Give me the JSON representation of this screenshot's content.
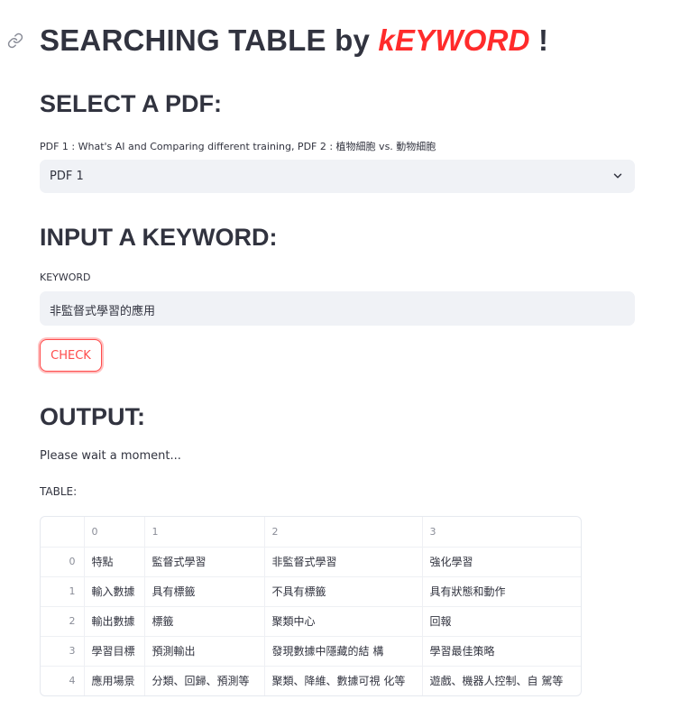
{
  "header": {
    "title_prefix": "SEARCHING TABLE by ",
    "title_keyword": "kEYWORD",
    "title_suffix": " !",
    "link_icon": "link-icon"
  },
  "select_section": {
    "heading": "SELECT A PDF:",
    "label": "PDF 1 : What's AI and Comparing different training, PDF 2 : 植物細胞 vs. 動物細胞",
    "selected_value": "PDF 1",
    "chevron_icon": "chevron-down-icon"
  },
  "input_section": {
    "heading": "INPUT A KEYWORD:",
    "label": "KEYWORD",
    "value": "非監督式學習的應用",
    "button_label": "CHECK"
  },
  "output_section": {
    "heading": "OUTPUT:",
    "status": "Please wait a moment...",
    "table_label": "TABLE:"
  },
  "table": {
    "columns": [
      "",
      "0",
      "1",
      "2",
      "3"
    ],
    "rows": [
      {
        "index": "0",
        "cells": [
          "特點",
          "監督式學習",
          "非監督式學習",
          "強化學習"
        ]
      },
      {
        "index": "1",
        "cells": [
          "輸入數據",
          "具有標籤",
          "不具有標籤",
          "具有狀態和動作"
        ]
      },
      {
        "index": "2",
        "cells": [
          "輸出數據",
          "標籤",
          "聚類中心",
          "回報"
        ]
      },
      {
        "index": "3",
        "cells": [
          "學習目標",
          "預測輸出",
          "發現數據中隱藏的結 構",
          "學習最佳策略"
        ]
      },
      {
        "index": "4",
        "cells": [
          "應用場景",
          "分類、回歸、預測等",
          "聚類、降維、數據可視 化等",
          "遊戲、機器人控制、自 駕等"
        ]
      }
    ]
  },
  "colors": {
    "accent": "#ff4b4b",
    "keyword": "#ff2b2b",
    "input_bg": "#f0f2f6",
    "text": "#31333f"
  }
}
